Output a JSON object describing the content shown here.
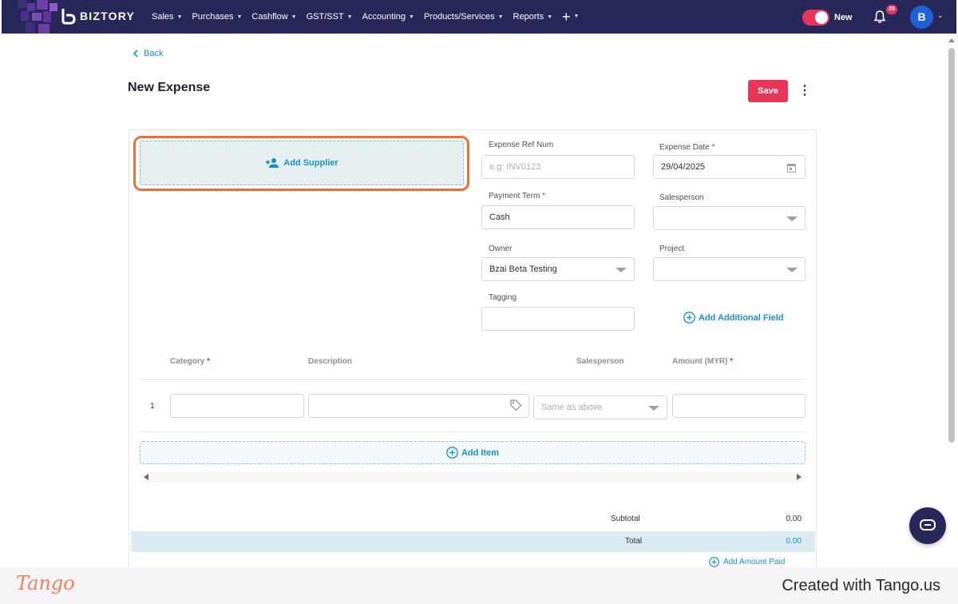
{
  "nav": {
    "brand": "BIZTORY",
    "items": [
      {
        "label": "Sales"
      },
      {
        "label": "Purchases"
      },
      {
        "label": "Cashflow"
      },
      {
        "label": "GST/SST"
      },
      {
        "label": "Accounting"
      },
      {
        "label": "Products/Services"
      },
      {
        "label": "Reports"
      }
    ],
    "plus": "+",
    "toggle_label": "New",
    "notification_count": "29",
    "avatar_initial": "B"
  },
  "colors": {
    "navbar": "#27275a",
    "accent_red": "#e8365b",
    "link_blue": "#1a8fc7",
    "highlight_orange": "#f26f34"
  },
  "header": {
    "back_label": "Back",
    "title": "New Expense",
    "save_label": "Save",
    "more_icon": "more-vertical-icon"
  },
  "form": {
    "add_supplier_label": "Add Supplier",
    "expense_ref": {
      "label": "Expense Ref Num",
      "placeholder": "e.g: INV0123",
      "value": ""
    },
    "expense_date": {
      "label": "Expense Date",
      "required": "*",
      "value": "29/04/2025"
    },
    "payment_term": {
      "label": "Payment Term",
      "required": "*",
      "value": "Cash"
    },
    "salesperson": {
      "label": "Salesperson",
      "value": ""
    },
    "owner": {
      "label": "Owner",
      "value": "Bzai Beta Testing"
    },
    "project": {
      "label": "Project",
      "value": ""
    },
    "tagging": {
      "label": "Tagging",
      "value": ""
    },
    "add_additional_field": "Add Additional Field"
  },
  "items_table": {
    "columns": {
      "category": "Category",
      "description": "Description",
      "salesperson": "Salesperson",
      "amount": "Amount (MYR)",
      "required": "*"
    },
    "rows": [
      {
        "num": "1",
        "category": "",
        "description": "",
        "salesperson_placeholder": "Same as above",
        "amount": ""
      }
    ],
    "add_item_label": "Add Item"
  },
  "totals": {
    "subtotal_label": "Subtotal",
    "subtotal_value": "0.00",
    "total_label": "Total",
    "total_value": "0.00",
    "add_amount_paid": "Add Amount Paid"
  },
  "watermark": {
    "logo": "Tango",
    "created": "Created with Tango.us"
  }
}
